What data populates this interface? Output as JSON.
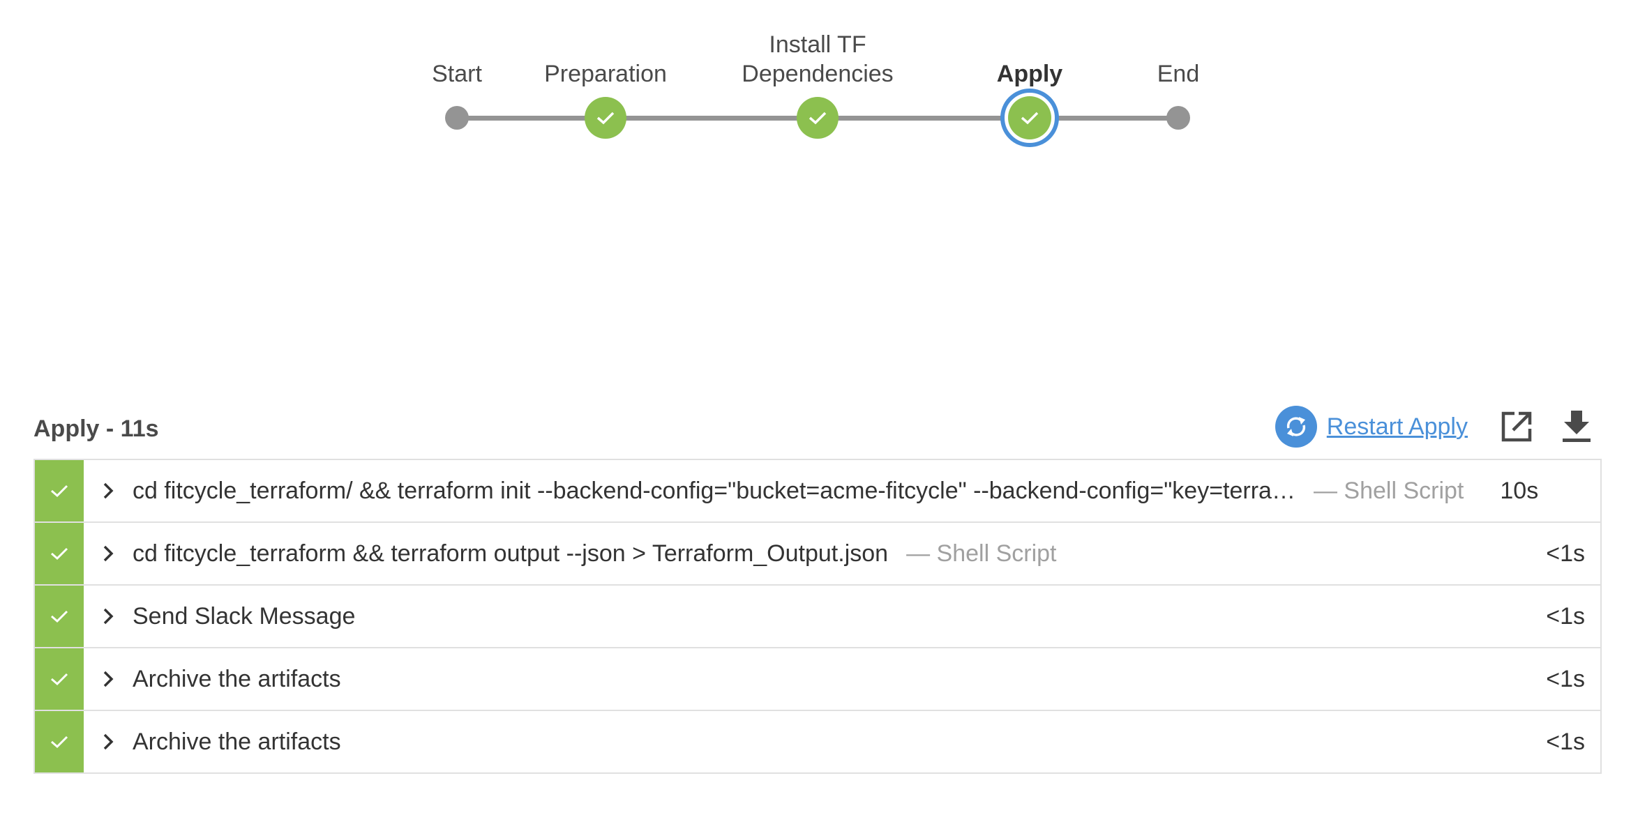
{
  "pipeline": {
    "stages": [
      {
        "label": "Start",
        "state": "start"
      },
      {
        "label": "Preparation",
        "state": "success"
      },
      {
        "label": "Install TF\nDependencies",
        "label_line1": "Install TF",
        "label_line2": "Dependencies",
        "state": "success"
      },
      {
        "label": "Apply",
        "state": "success",
        "selected": true
      },
      {
        "label": "End",
        "state": "end"
      }
    ]
  },
  "stage_header": {
    "title": "Apply - 11s",
    "restart_label": "Restart Apply",
    "icons": [
      "restart-icon",
      "open-in-new-window-icon",
      "download-icon"
    ]
  },
  "steps": [
    {
      "text": "cd fitcycle_terraform/ && terraform init --backend-config=\"bucket=acme-fitcycle\" --backend-config=\"key=terra…",
      "type": "— Shell Script",
      "duration": "10s",
      "status": "success"
    },
    {
      "text": "cd fitcycle_terraform && terraform output --json > Terraform_Output.json",
      "type": "— Shell Script",
      "duration": "<1s",
      "status": "success"
    },
    {
      "text": "Send Slack Message",
      "type": "",
      "duration": "<1s",
      "status": "success"
    },
    {
      "text": "Archive the artifacts",
      "type": "",
      "duration": "<1s",
      "status": "success"
    },
    {
      "text": "Archive the artifacts",
      "type": "",
      "duration": "<1s",
      "status": "success"
    }
  ],
  "colors": {
    "success": "#8cc04f",
    "selected_ring": "#4a90d9",
    "link": "#4a90d9",
    "track": "#949494"
  }
}
